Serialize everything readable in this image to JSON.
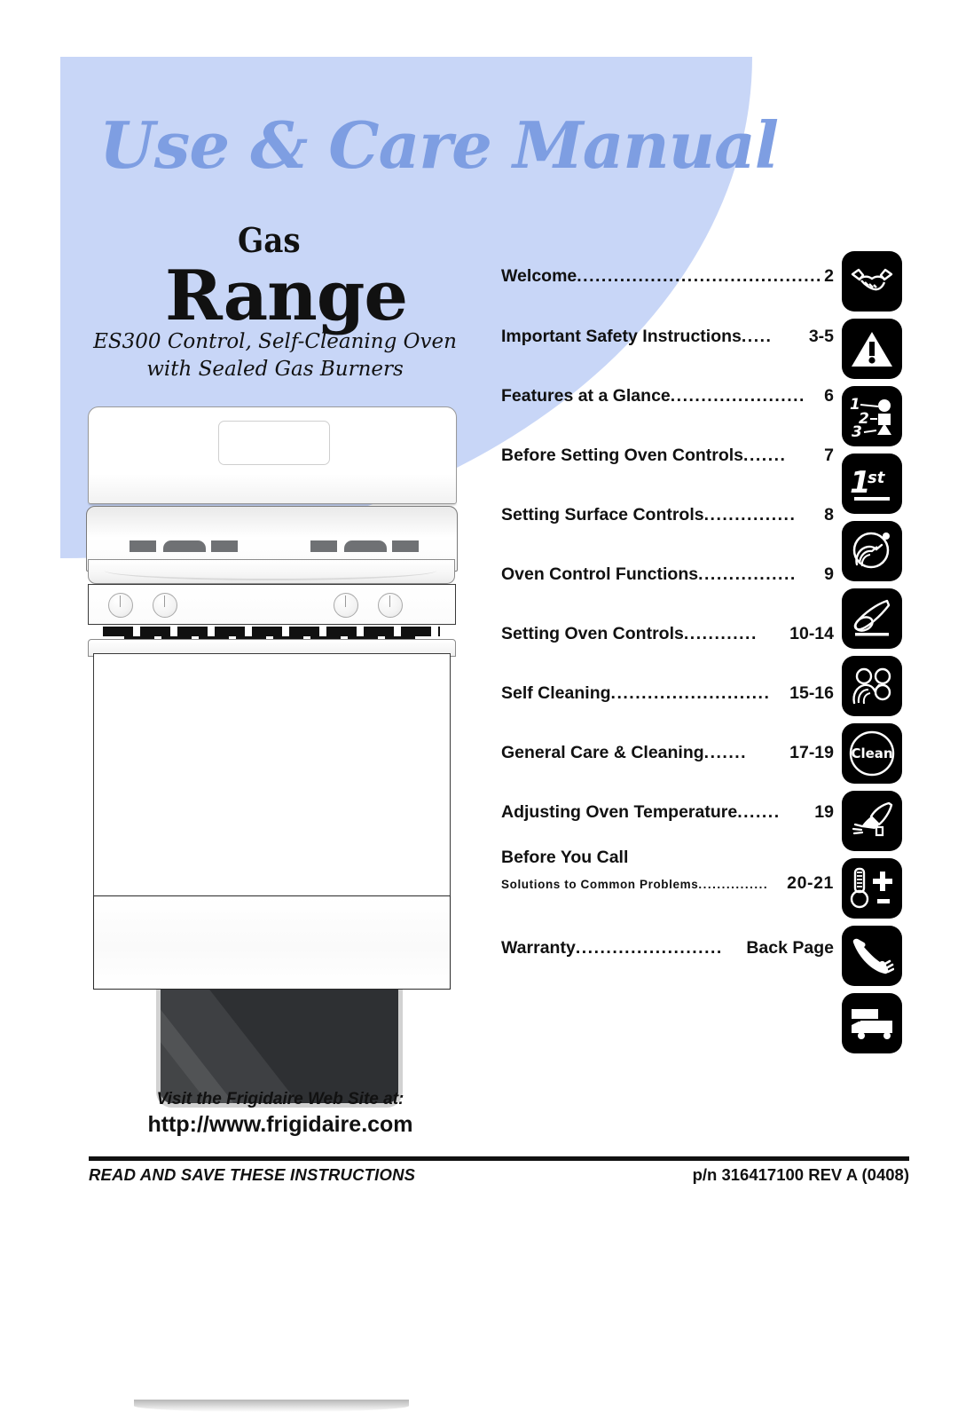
{
  "cover": {
    "title": "Use & Care Manual",
    "product_kind": "Gas",
    "product_name": "Range",
    "model_line_1": "ES300 Control, Self-Cleaning Oven",
    "model_line_2": "with Sealed Gas Burners",
    "accent_blue": "#c8d6f7",
    "title_blue": "#7e9ee2"
  },
  "toc": {
    "entries": [
      {
        "label": "Welcome",
        "dots": "........................................",
        "page": "2",
        "icon": "handshake-icon"
      },
      {
        "label": "Important Safety Instructions",
        "dots": ".....",
        "page": "3-5",
        "icon": "warning-triangle-icon"
      },
      {
        "label": "Features at a Glance",
        "dots": "......................",
        "page": "6",
        "icon": "numbered-list-icon"
      },
      {
        "label": "Before Setting Oven Controls",
        "dots": ".......",
        "page": "7",
        "icon": "first-icon"
      },
      {
        "label": "Setting Surface Controls",
        "dots": "...............",
        "page": "8",
        "icon": "hand-burner-icon"
      },
      {
        "label": "Oven Control Functions",
        "dots": "................",
        "page": "9",
        "icon": "oven-mitt-icon"
      },
      {
        "label": "Setting Oven Controls",
        "dots": "............",
        "page": "10-14",
        "icon": "hand-dials-icon"
      },
      {
        "label": "Self Cleaning",
        "dots": "..........................",
        "page": "15-16",
        "icon": "clean-circle-icon"
      },
      {
        "label": "General Care & Cleaning",
        "dots": ".......",
        "page": "17-19",
        "icon": "hand-wiping-icon"
      },
      {
        "label": "Adjusting Oven Temperature",
        "dots": ".......",
        "page": "19",
        "icon": "thermometer-plus-minus-icon"
      }
    ],
    "before_you_call": {
      "heading": "Before You  Call",
      "sub_label": "Solutions to Common Problems",
      "sub_dots": "...............",
      "sub_page": "20-21",
      "icon": "telephone-icon"
    },
    "warranty": {
      "label": "Warranty",
      "dots": "........................",
      "page": "Back Page",
      "icon": "delivery-truck-icon"
    },
    "clean_icon_text": "Clean"
  },
  "footer": {
    "web_intro": "Visit the Frigidaire Web Site at:",
    "web_url": "http://www.frigidaire.com",
    "instruction": "READ AND SAVE THESE INSTRUCTIONS",
    "part_number": "p/n 316417100 REV A (0408)"
  }
}
